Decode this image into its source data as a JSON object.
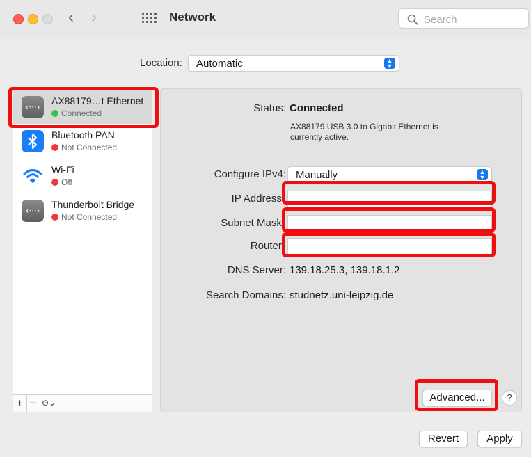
{
  "window": {
    "title": "Network",
    "search_placeholder": "Search",
    "back_glyph": "‹",
    "forward_glyph": "›"
  },
  "location": {
    "label": "Location:",
    "value": "Automatic"
  },
  "services": [
    {
      "name": "AX88179…t Ethernet",
      "status": "Connected",
      "status_color": "#2bc941",
      "icon": "ethernet-icon",
      "selected": true
    },
    {
      "name": "Bluetooth PAN",
      "status": "Not Connected",
      "status_color": "#f0383a",
      "icon": "bluetooth-icon",
      "selected": false
    },
    {
      "name": "Wi-Fi",
      "status": "Off",
      "status_color": "#f0383a",
      "icon": "wifi-icon",
      "selected": false
    },
    {
      "name": "Thunderbolt Bridge",
      "status": "Not Connected",
      "status_color": "#f0383a",
      "icon": "ethernet-icon",
      "selected": false
    }
  ],
  "sidebar_toolbar": {
    "add": "+",
    "remove": "−",
    "action": "⊖⌄"
  },
  "detail": {
    "status_label": "Status:",
    "status_value": "Connected",
    "status_description": "AX88179 USB 3.0 to Gigabit Ethernet is currently active.",
    "configure_label": "Configure IPv4:",
    "configure_value": "Manually",
    "ip_label": "IP Address:",
    "ip_value": "",
    "subnet_label": "Subnet Mask:",
    "subnet_value": "",
    "router_label": "Router:",
    "router_value": "",
    "dns_label": "DNS Server:",
    "dns_value": "139.18.25.3, 139.18.1.2",
    "search_domains_label": "Search Domains:",
    "search_domains_value": "studnetz.uni-leipzig.de",
    "advanced_label": "Advanced...",
    "help_label": "?"
  },
  "footer": {
    "revert_label": "Revert",
    "apply_label": "Apply"
  },
  "colors": {
    "highlight": "#ee1010",
    "accent": "#1478f0"
  }
}
